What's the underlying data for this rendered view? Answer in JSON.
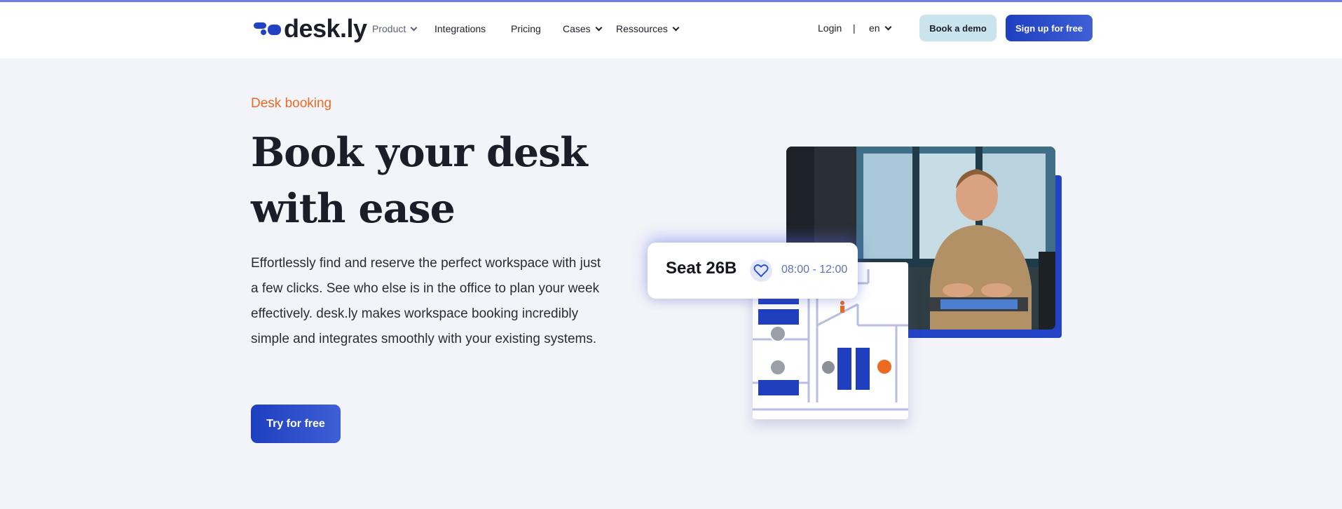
{
  "header": {
    "logo_text": "desk.ly",
    "nav": [
      {
        "label": "Product",
        "has_dropdown": true
      },
      {
        "label": "Integrations",
        "has_dropdown": false
      },
      {
        "label": "Pricing",
        "has_dropdown": false
      },
      {
        "label": "Cases",
        "has_dropdown": true
      },
      {
        "label": "Ressources",
        "has_dropdown": true
      }
    ],
    "login_label": "Login",
    "separator": "|",
    "language": "en",
    "demo_button": "Book a demo",
    "signup_button": "Sign up for free"
  },
  "hero": {
    "eyebrow": "Desk booking",
    "title": "Book your desk with ease",
    "description": "Effortlessly find and reserve the perfect workspace with just a few clicks. See who else is in the office to plan your week effectively. desk.ly makes workspace booking incredibly simple and integrates smoothly with your existing systems.",
    "cta_button": "Try for free"
  },
  "booking_card": {
    "seat": "Seat 26B",
    "icon": "heart-icon",
    "time": "08:00 - 12:00"
  },
  "colors": {
    "brand_blue": "#2342c2",
    "accent_orange": "#ec6b23",
    "light_button": "#c9e4ec",
    "background": "#f3f4f9"
  }
}
